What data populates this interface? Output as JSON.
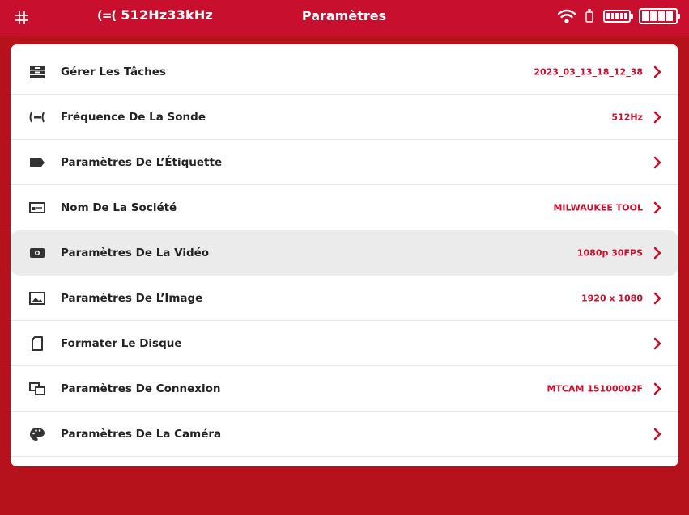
{
  "status_bar": {
    "probe_glyph": "(=(",
    "frequency": "512Hz33kHz",
    "title": "Paramètres",
    "icons": [
      "grid-icon",
      "wifi-icon",
      "device-icon",
      "battery-small-icon",
      "battery-icon"
    ],
    "battery_level": 1.0
  },
  "colors": {
    "accent": "#c8102e",
    "background": "#b5121b",
    "panel": "#ffffff",
    "selected_row": "#ebebeb",
    "label_text": "#222222"
  },
  "settings": [
    {
      "icon": "tasks-icon",
      "label": "Gérer Les Tâches",
      "value": "2023_03_13_18_12_38"
    },
    {
      "icon": "probe-icon",
      "label": "Fréquence De La Sonde",
      "value": "512Hz"
    },
    {
      "icon": "tag-icon",
      "label": "Paramètres De L’Étiquette",
      "value": ""
    },
    {
      "icon": "company-card-icon",
      "label": "Nom De La Société",
      "value": "MILWAUKEE TOOL"
    },
    {
      "icon": "video-icon",
      "label": "Paramètres De La Vidéo",
      "value": "1080p 30FPS",
      "selected": true
    },
    {
      "icon": "image-icon",
      "label": "Paramètres De L’Image",
      "value": "1920 x 1080"
    },
    {
      "icon": "sd-card-icon",
      "label": "Formater Le Disque",
      "value": ""
    },
    {
      "icon": "connection-icon",
      "label": "Paramètres De Connexion",
      "value": "MTCAM 15100002F"
    },
    {
      "icon": "palette-icon",
      "label": "Paramètres De La Caméra",
      "value": ""
    }
  ]
}
